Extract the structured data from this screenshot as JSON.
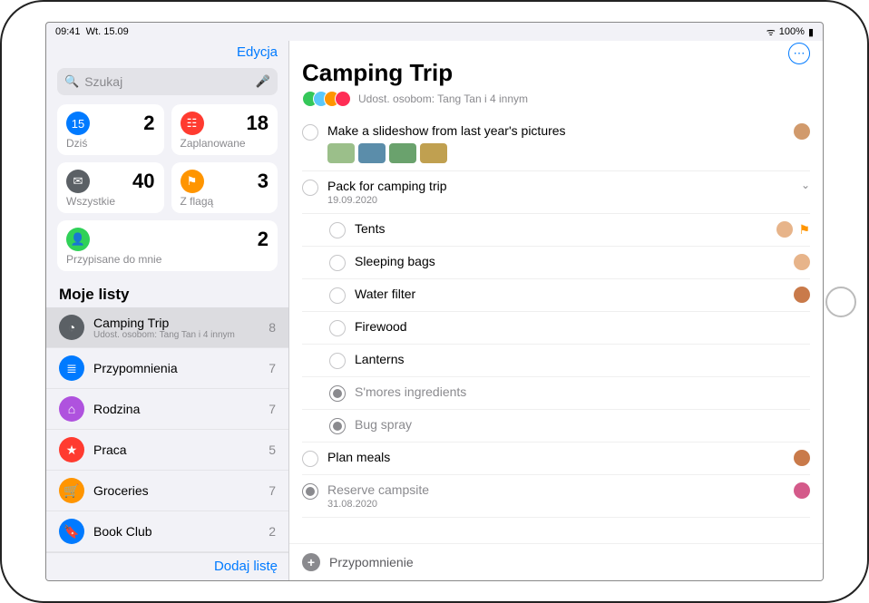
{
  "status": {
    "time": "09:41",
    "date": "Wt. 15.09",
    "battery": "100%"
  },
  "sidebar": {
    "edit": "Edycja",
    "search_placeholder": "Szukaj",
    "cards": {
      "today": {
        "label": "Dziś",
        "count": "2",
        "color": "#007aff",
        "glyph": "15"
      },
      "scheduled": {
        "label": "Zaplanowane",
        "count": "18",
        "color": "#ff3b30",
        "glyph": "☷"
      },
      "all": {
        "label": "Wszystkie",
        "count": "40",
        "color": "#5b6065",
        "glyph": "✉"
      },
      "flagged": {
        "label": "Z flagą",
        "count": "3",
        "color": "#ff9500",
        "glyph": "⚑"
      },
      "assigned": {
        "label": "Przypisane do mnie",
        "count": "2",
        "color": "#30d158",
        "glyph": "👤"
      }
    },
    "section": "Moje listy",
    "lists": [
      {
        "name": "Camping Trip",
        "sub": "Udost. osobom: Tang Tan i 4 innym",
        "count": "8",
        "color": "#5b6065",
        "glyph": "◔",
        "selected": true
      },
      {
        "name": "Przypomnienia",
        "count": "7",
        "color": "#007aff",
        "glyph": "≣"
      },
      {
        "name": "Rodzina",
        "count": "7",
        "color": "#af52de",
        "glyph": "⌂"
      },
      {
        "name": "Praca",
        "count": "5",
        "color": "#ff3b30",
        "glyph": "★"
      },
      {
        "name": "Groceries",
        "count": "7",
        "color": "#ff9500",
        "glyph": "🛒"
      },
      {
        "name": "Book Club",
        "count": "2",
        "color": "#007aff",
        "glyph": "🔖"
      }
    ],
    "add_list": "Dodaj listę"
  },
  "main": {
    "title": "Camping Trip",
    "shared": "Udost. osobom: Tang Tan i 4 innym",
    "avatars": [
      "#34c759",
      "#5ac8fa",
      "#ff9500",
      "#ff2d55"
    ],
    "items": [
      {
        "title": "Make a slideshow from last year's pictures",
        "thumbs": [
          "#9bbf8a",
          "#5b8daa",
          "#6aa26d",
          "#c0a050"
        ],
        "assignee": "#d19a6c"
      },
      {
        "title": "Pack for camping trip",
        "date": "19.09.2020",
        "expandable": true,
        "subs": [
          {
            "title": "Tents",
            "assignee": "#e7b48a",
            "flag": true
          },
          {
            "title": "Sleeping bags",
            "assignee": "#e7b48a"
          },
          {
            "title": "Water filter",
            "assignee": "#c97a4a"
          },
          {
            "title": "Firewood"
          },
          {
            "title": "Lanterns"
          },
          {
            "title": "S'mores ingredients",
            "done": true
          },
          {
            "title": "Bug spray",
            "done": true
          }
        ]
      },
      {
        "title": "Plan meals",
        "assignee": "#c97a4a"
      },
      {
        "title": "Reserve campsite",
        "date": "31.08.2020",
        "done": true,
        "assignee": "#d45a8a"
      }
    ],
    "add": "Przypomnienie"
  }
}
